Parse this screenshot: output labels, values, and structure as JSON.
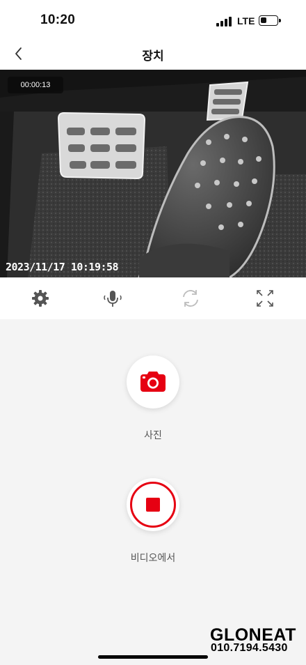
{
  "status_bar": {
    "time": "10:20",
    "network": "LTE",
    "signal_bars": 4,
    "battery_level": 0.25
  },
  "header": {
    "title": "장치",
    "back_icon": "chevron-left-icon"
  },
  "video": {
    "elapsed": "00:00:13",
    "timestamp": "2023/11/17  10:19:58"
  },
  "toolbar": {
    "icons": [
      "gear-icon",
      "microphone-icon",
      "rotate-icon",
      "fullscreen-icon"
    ]
  },
  "actions": {
    "photo": {
      "label": "사진",
      "icon": "camera-icon"
    },
    "video": {
      "label": "비디오에서",
      "icon": "stop-record-icon"
    }
  },
  "watermark": {
    "brand": "GLONEAT",
    "phone": "010.7194.5430"
  },
  "colors": {
    "accent": "#e60012",
    "background": "#f4f4f4",
    "surface": "#ffffff"
  }
}
